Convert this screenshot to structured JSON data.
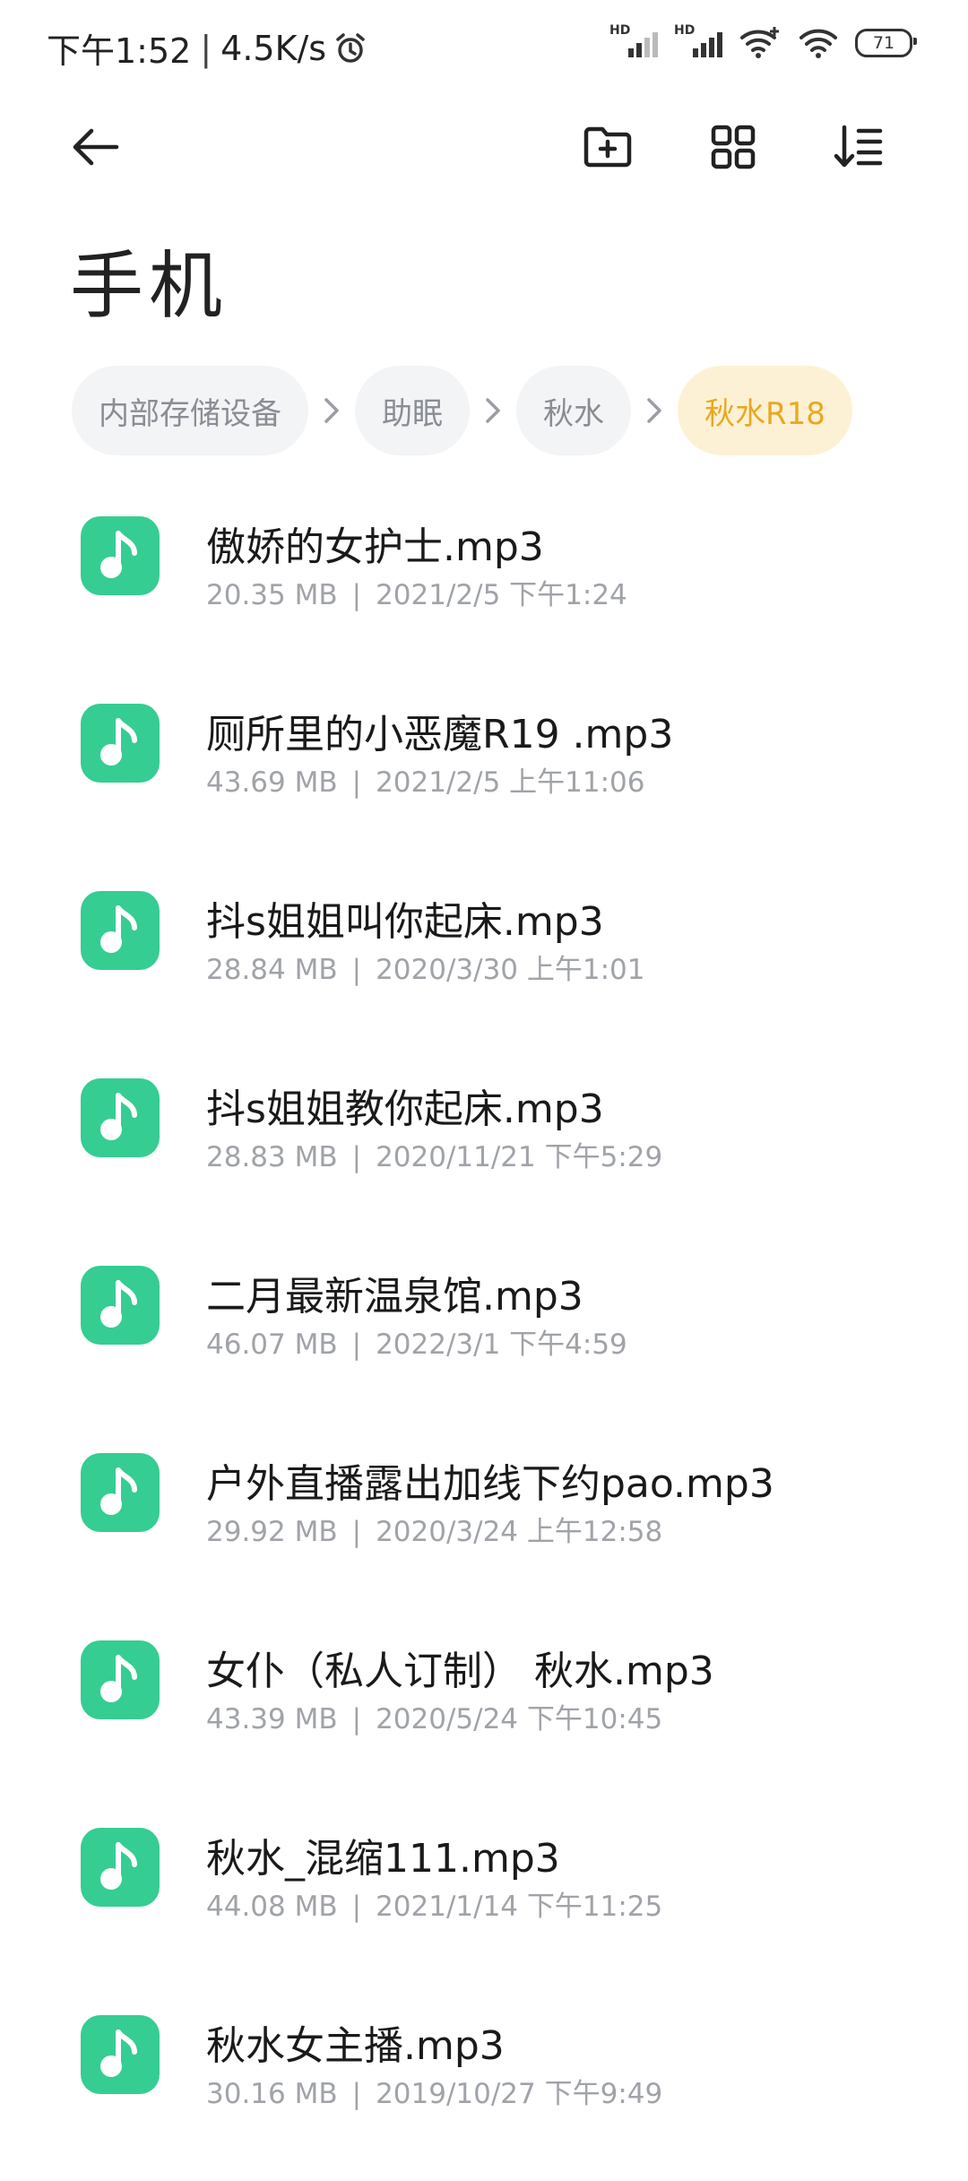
{
  "status_bar": {
    "time": "下午1:52",
    "separator": "|",
    "net_speed": "4.5K/s",
    "sim1_label": "HD",
    "sim2_label": "HD",
    "battery": "71"
  },
  "toolbar": {
    "back_icon": "arrow-left-icon",
    "new_folder_icon": "folder-plus-icon",
    "grid_view_icon": "grid-icon",
    "sort_icon": "sort-icon"
  },
  "title": "手机",
  "breadcrumb": [
    "内部存储设备",
    "助眠",
    "秋水",
    "秋水R18"
  ],
  "colors": {
    "accent": "#e9a820",
    "file_icon": "#35cd92"
  },
  "files": [
    {
      "name": "傲娇的女护士.mp3",
      "size": "20.35 MB",
      "date": "2021/2/5 下午1:24"
    },
    {
      "name": "厕所里的小恶魔R19 .mp3",
      "size": "43.69 MB",
      "date": "2021/2/5 上午11:06"
    },
    {
      "name": "抖s姐姐叫你起床.mp3",
      "size": "28.84 MB",
      "date": "2020/3/30 上午1:01"
    },
    {
      "name": "抖s姐姐教你起床.mp3",
      "size": "28.83 MB",
      "date": "2020/11/21 下午5:29"
    },
    {
      "name": "二月最新温泉馆.mp3",
      "size": "46.07 MB",
      "date": "2022/3/1 下午4:59"
    },
    {
      "name": "户外直播露出加线下约pao.mp3",
      "size": "29.92 MB",
      "date": "2020/3/24 上午12:58"
    },
    {
      "name": "女仆（私人订制） 秋水.mp3",
      "size": "43.39 MB",
      "date": "2020/5/24 下午10:45"
    },
    {
      "name": "秋水_混缩111.mp3",
      "size": "44.08 MB",
      "date": "2021/1/14 下午11:25"
    },
    {
      "name": "秋水女主播.mp3",
      "size": "30.16 MB",
      "date": "2019/10/27 下午9:49"
    }
  ]
}
